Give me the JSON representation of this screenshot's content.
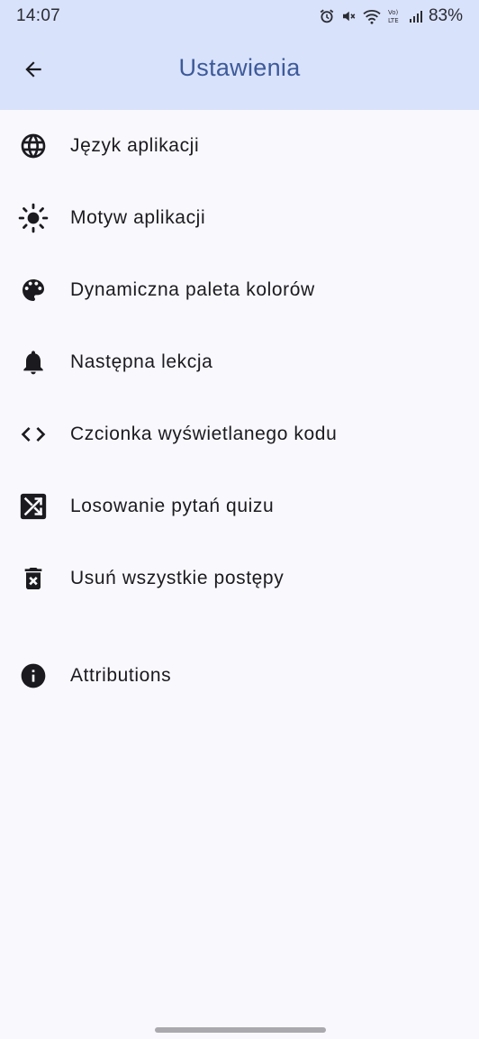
{
  "status_bar": {
    "time": "14:07",
    "battery": "83%"
  },
  "app_bar": {
    "title": "Ustawienia",
    "back_icon": "arrow-back-icon"
  },
  "settings": {
    "items": [
      {
        "label": "Język aplikacji",
        "icon": "globe-icon"
      },
      {
        "label": "Motyw aplikacji",
        "icon": "brightness-icon"
      },
      {
        "label": "Dynamiczna paleta kolorów",
        "icon": "palette-icon"
      },
      {
        "label": "Następna lekcja",
        "icon": "bell-icon"
      },
      {
        "label": "Czcionka wyświetlanego kodu",
        "icon": "code-icon"
      },
      {
        "label": "Losowanie pytań quizu",
        "icon": "shuffle-icon"
      },
      {
        "label": "Usuń wszystkie postępy",
        "icon": "delete-forever-icon"
      },
      {
        "label": "Attributions",
        "icon": "info-icon"
      }
    ]
  },
  "colors": {
    "app_bar_bg": "#d9e2fb",
    "title": "#3d5a99",
    "background": "#f9f8fd"
  }
}
